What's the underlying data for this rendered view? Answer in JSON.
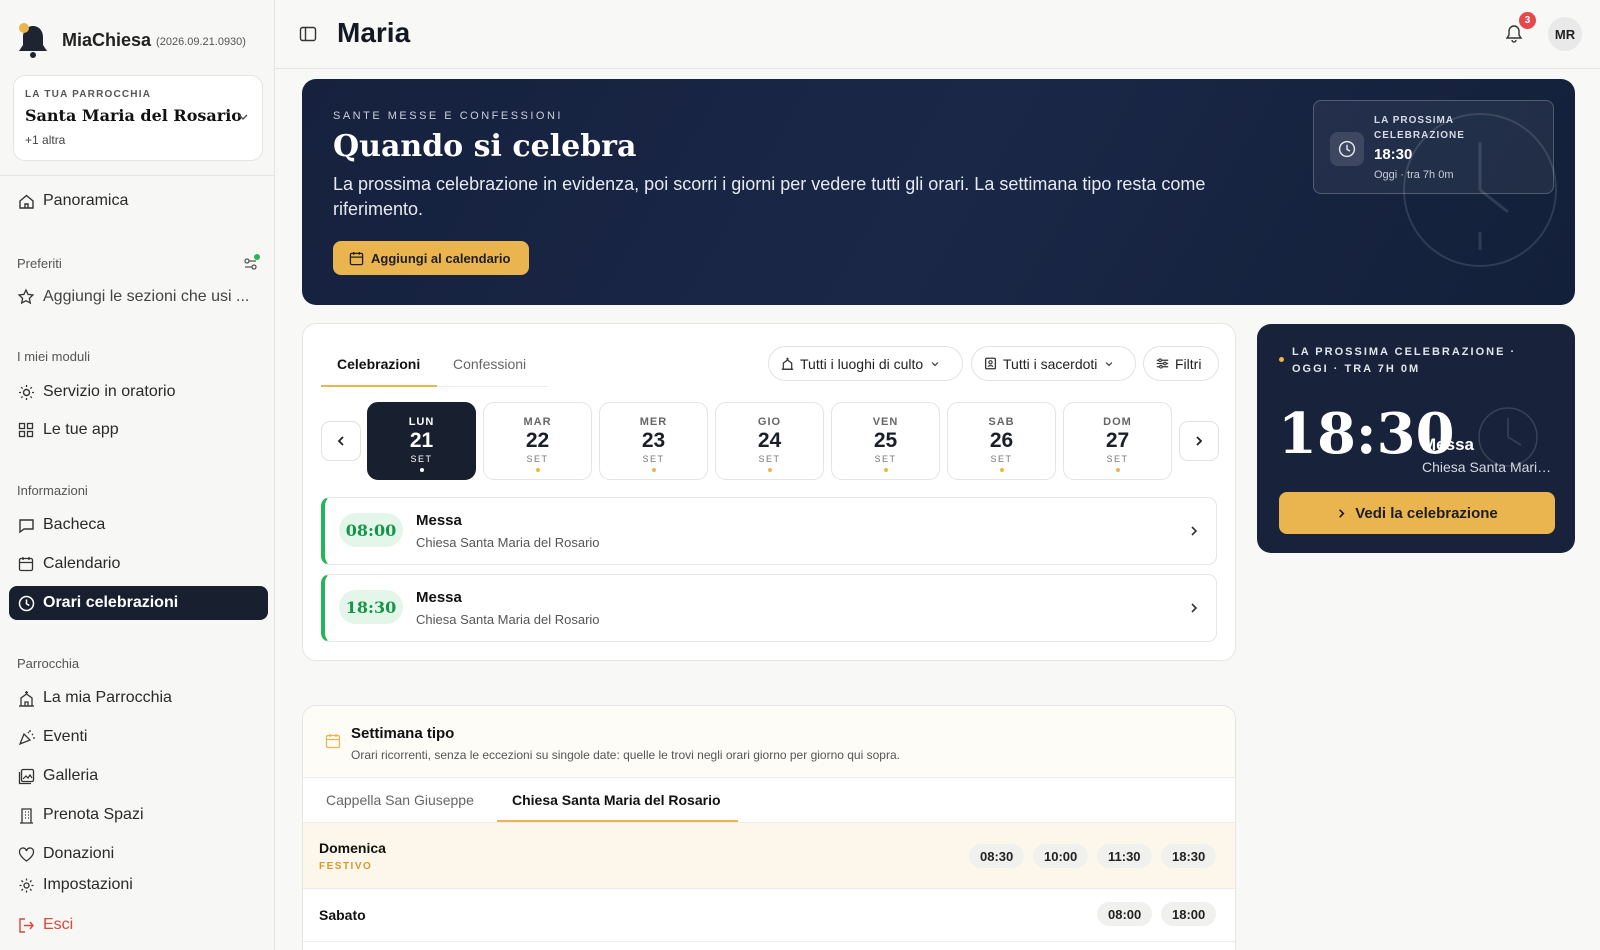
{
  "app": {
    "name": "MiaChiesa",
    "version": "(2026.09.21.0930)"
  },
  "parish": {
    "kicker": "LA TUA PARROCCHIA",
    "name": "Santa Maria del Rosario",
    "more": "+1 altra"
  },
  "nav": {
    "overview": "Panoramica",
    "favorites_title": "Preferiti",
    "favorites_add": "Aggiungi le sezioni che usi ...",
    "modules_title": "I miei moduli",
    "modules": [
      "Servizio in oratorio",
      "Le tue app"
    ],
    "info_title": "Informazioni",
    "info": [
      "Bacheca",
      "Calendario",
      "Orari celebrazioni"
    ],
    "parish_title": "Parrocchia",
    "parish_items": [
      "La mia Parrocchia",
      "Eventi",
      "Galleria",
      "Prenota Spazi",
      "Donazioni"
    ],
    "settings": "Impostazioni",
    "logout": "Esci"
  },
  "header": {
    "title": "Maria",
    "notifications": "3",
    "avatar": "MR"
  },
  "hero": {
    "kicker": "SANTE MESSE E CONFESSIONI",
    "title": "Quando si celebra",
    "description": "La prossima celebrazione in evidenza, poi scorri i giorni per vedere tutti gli orari. La settimana tipo resta come riferimento.",
    "button": "Aggiungi al calendario",
    "next": {
      "kicker": "LA PROSSIMA CELEBRAZIONE",
      "time": "18:30",
      "sub": "Oggi · tra 7h 0m"
    }
  },
  "schedule": {
    "tabs": [
      "Celebrazioni",
      "Confessioni"
    ],
    "filters": {
      "places": "Tutti i luoghi di culto",
      "priests": "Tutti i sacerdoti",
      "more": "Filtri"
    },
    "days": [
      {
        "name": "LUN",
        "num": "21",
        "month": "SET"
      },
      {
        "name": "MAR",
        "num": "22",
        "month": "SET"
      },
      {
        "name": "MER",
        "num": "23",
        "month": "SET"
      },
      {
        "name": "GIO",
        "num": "24",
        "month": "SET"
      },
      {
        "name": "VEN",
        "num": "25",
        "month": "SET"
      },
      {
        "name": "SAB",
        "num": "26",
        "month": "SET"
      },
      {
        "name": "DOM",
        "num": "27",
        "month": "SET"
      }
    ],
    "celebrations": [
      {
        "time": "08:00",
        "title": "Messa",
        "place": "Chiesa Santa Maria del Rosario"
      },
      {
        "time": "18:30",
        "title": "Messa",
        "place": "Chiesa Santa Maria del Rosario"
      }
    ]
  },
  "next_card": {
    "kicker": "LA PROSSIMA CELEBRAZIONE · OGGI · TRA 7H 0M",
    "time": "18:30",
    "title": "Messa",
    "place": "Chiesa Santa Maria del Rosario",
    "button": "Vedi la celebrazione"
  },
  "week": {
    "title": "Settimana tipo",
    "subtitle": "Orari ricorrenti, senza le eccezioni su singole date: quelle le trovi negli orari giorno per giorno qui sopra.",
    "tabs": [
      "Cappella San Giuseppe",
      "Chiesa Santa Maria del Rosario"
    ],
    "rows": [
      {
        "day": "Domenica",
        "tag": "FESTIVO",
        "times": [
          "08:30",
          "10:00",
          "11:30",
          "18:30"
        ]
      },
      {
        "day": "Sabato",
        "tag": "",
        "times": [
          "08:00",
          "18:00"
        ]
      }
    ]
  },
  "colors": {
    "accent": "#eab44e",
    "navy": "#18202f",
    "green": "#22b65b",
    "badge": "#e5484d"
  }
}
